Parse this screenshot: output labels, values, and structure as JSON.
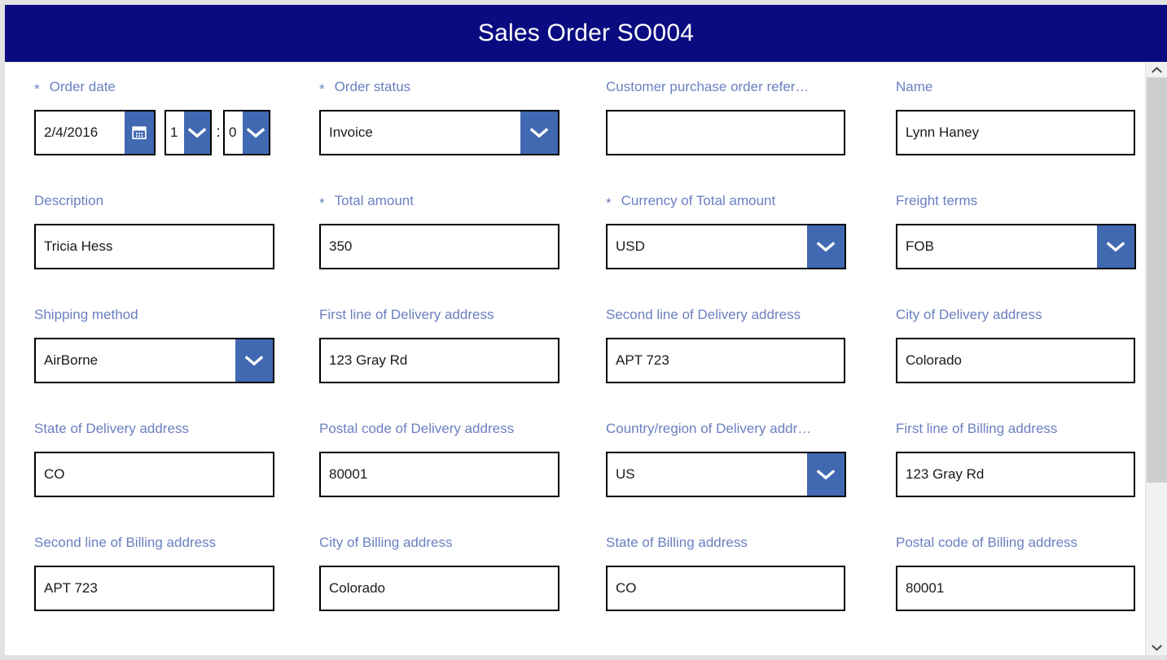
{
  "window": {
    "title": "Sales Order SO004",
    "header_bg": "#0b0b81",
    "accent_blue": "#4169b2",
    "label_color": "#6a7fc1"
  },
  "form": {
    "fields": [
      {
        "name": "order-date",
        "label": "Order date",
        "required": true,
        "type": "datetime",
        "date_value": "2/4/2016",
        "hour_value": "1",
        "time_separator": ":",
        "minute_value": "0",
        "calendar_icon": "calendar-icon",
        "hour_icon": "chevron-down-icon",
        "minute_icon": "chevron-down-icon"
      },
      {
        "name": "order-status",
        "label": "Order status",
        "required": true,
        "type": "select",
        "value": "Invoice",
        "icon": "chevron-down-icon"
      },
      {
        "name": "customer-purchase-order-reference",
        "label": "Customer purchase order refer…",
        "required": false,
        "type": "text",
        "value": "",
        "placeholder": ""
      },
      {
        "name": "name",
        "label": "Name",
        "required": false,
        "type": "text",
        "value": "Lynn Haney",
        "placeholder": ""
      },
      {
        "name": "description",
        "label": "Description",
        "required": false,
        "type": "text",
        "value": "Tricia Hess",
        "placeholder": ""
      },
      {
        "name": "total-amount",
        "label": "Total amount",
        "required": true,
        "type": "text",
        "value": "350",
        "placeholder": ""
      },
      {
        "name": "currency-of-total-amount",
        "label": "Currency of Total amount",
        "required": true,
        "type": "select",
        "value": "USD",
        "icon": "chevron-down-icon"
      },
      {
        "name": "freight-terms",
        "label": "Freight terms",
        "required": false,
        "type": "select",
        "value": "FOB",
        "icon": "chevron-down-icon"
      },
      {
        "name": "shipping-method",
        "label": "Shipping method",
        "required": false,
        "type": "select",
        "value": "AirBorne",
        "icon": "chevron-down-icon"
      },
      {
        "name": "first-line-of-delivery-address",
        "label": "First line of Delivery address",
        "required": false,
        "type": "text",
        "value": "123 Gray Rd",
        "placeholder": ""
      },
      {
        "name": "second-line-of-delivery-address",
        "label": "Second line of Delivery address",
        "required": false,
        "type": "text",
        "value": "APT 723",
        "placeholder": ""
      },
      {
        "name": "city-of-delivery-address",
        "label": "City of Delivery address",
        "required": false,
        "type": "text",
        "value": "Colorado",
        "placeholder": ""
      },
      {
        "name": "state-of-delivery-address",
        "label": "State of Delivery address",
        "required": false,
        "type": "text",
        "value": "CO",
        "placeholder": ""
      },
      {
        "name": "postal-code-of-delivery-address",
        "label": "Postal code of Delivery address",
        "required": false,
        "type": "text",
        "value": "80001",
        "placeholder": ""
      },
      {
        "name": "country-region-of-delivery-address",
        "label": "Country/region of Delivery addr…",
        "required": false,
        "type": "select",
        "value": "US",
        "icon": "chevron-down-icon"
      },
      {
        "name": "first-line-of-billing-address",
        "label": "First line of Billing address",
        "required": false,
        "type": "text",
        "value": "123 Gray Rd",
        "placeholder": ""
      },
      {
        "name": "second-line-of-billing-address",
        "label": "Second line of Billing address",
        "required": false,
        "type": "text",
        "value": "APT 723",
        "placeholder": ""
      },
      {
        "name": "city-of-billing-address",
        "label": "City of Billing address",
        "required": false,
        "type": "text",
        "value": "Colorado",
        "placeholder": ""
      },
      {
        "name": "state-of-billing-address",
        "label": "State of Billing address",
        "required": false,
        "type": "text",
        "value": "CO",
        "placeholder": ""
      },
      {
        "name": "postal-code-of-billing-address",
        "label": "Postal code of Billing address",
        "required": false,
        "type": "text",
        "value": "80001",
        "placeholder": ""
      }
    ],
    "required_marker": "*"
  },
  "scrollbar": {
    "up_icon": "chevron-up-icon",
    "down_icon": "chevron-down-icon",
    "thumb_top_pct": 0,
    "thumb_height_pct": 72
  }
}
